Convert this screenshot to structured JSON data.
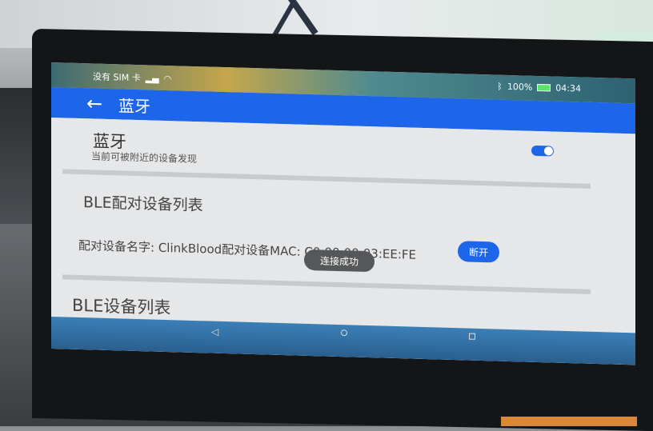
{
  "status_bar": {
    "carrier": "没有 SIM 卡",
    "signal_icon": "signal-icon",
    "wifi_icon": "wifi-icon",
    "bluetooth_icon": "bluetooth-icon",
    "battery_percent": "100%",
    "time": "04:34"
  },
  "app_bar": {
    "back_icon": "←",
    "title": "蓝牙"
  },
  "bluetooth": {
    "title": "蓝牙",
    "subtitle": "当前可被附近的设备发现",
    "enabled": true
  },
  "paired_section": {
    "header": "BLE配对设备列表",
    "items": [
      {
        "text": "配对设备名字: ClinkBlood配对设备MAC: C0:00:00:03:EE:FE",
        "action": "断开"
      }
    ]
  },
  "toast": "连接成功",
  "device_section": {
    "header": "BLE设备列表"
  },
  "colors": {
    "accent": "#1e66e9",
    "content_bg": "#e6e7e9"
  }
}
